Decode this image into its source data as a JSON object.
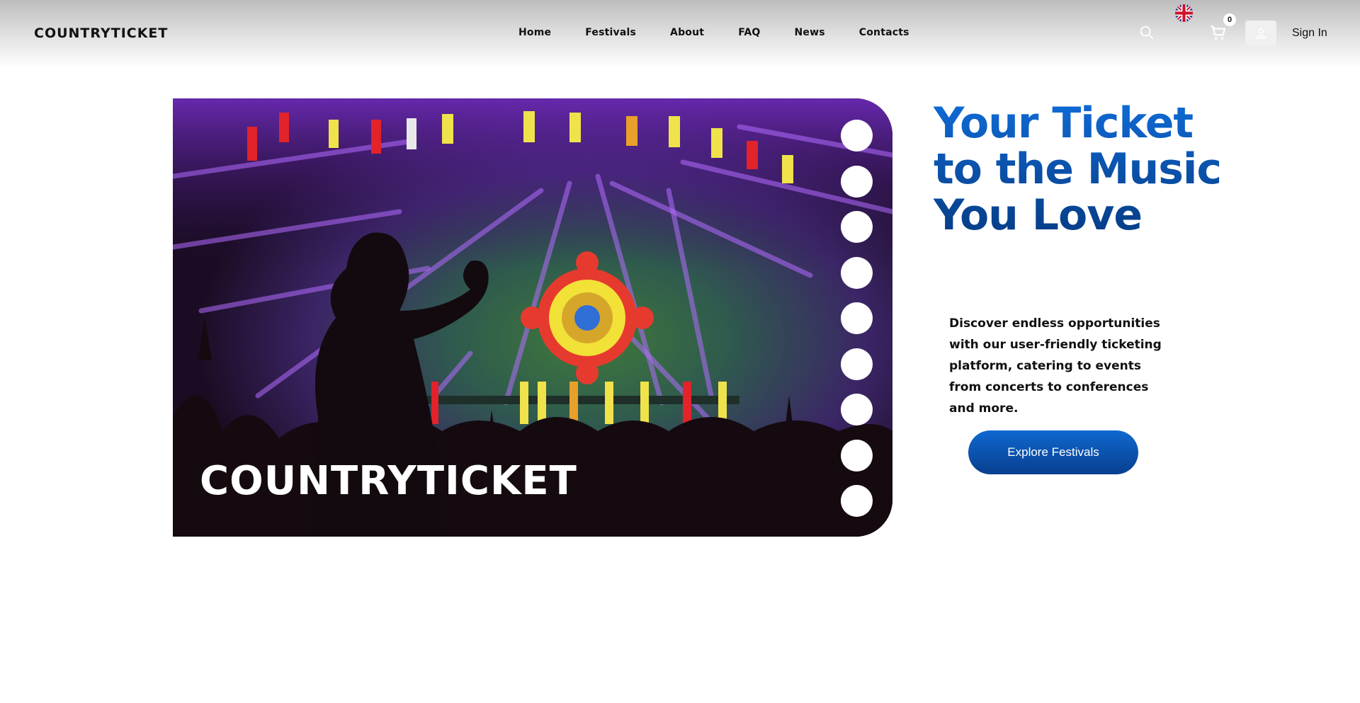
{
  "header": {
    "logo": "COUNTRYTICKET",
    "nav": [
      "Home",
      "Festivals",
      "About",
      "FAQ",
      "News",
      "Contacts"
    ],
    "cart_count": "0",
    "sign_in": "Sign In",
    "language_flag": "uk-flag-icon"
  },
  "hero": {
    "image_brand": "COUNTRYTICKET",
    "headline": "Your Ticket to the Music You Love",
    "description": "Discover endless opportunities with our user-friendly ticketing platform, catering to events from concerts to conferences and more.",
    "cta_label": "Explore Festivals"
  },
  "colors": {
    "accent": "#0A56B8",
    "accent_dark": "#063C86"
  },
  "icons": [
    "search-icon",
    "cart-icon",
    "user-icon",
    "uk-flag-icon"
  ]
}
